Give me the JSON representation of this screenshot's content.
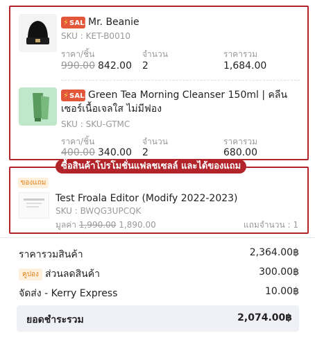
{
  "sale_label": "SALE",
  "col_labels": {
    "price": "ราคา/ชิ้น",
    "qty": "จำนวน",
    "total": "ราคารวม"
  },
  "items": [
    {
      "name": "Mr. Beanie",
      "sku": "SKU : KET-B0010",
      "original_price": "990.00",
      "price": "842.00",
      "qty": "2",
      "total": "1,684.00"
    },
    {
      "name": "Green Tea Morning Cleanser 150ml | คลีนเซอร์เนื้อเจลใส ไม่มีฟอง",
      "sku": "SKU : SKU-GTMC",
      "original_price": "400.00",
      "price": "340.00",
      "qty": "2",
      "total": "680.00"
    }
  ],
  "promo_banner": "ซื้อสินค้าโปรโมชั่นแฟลชเซลล์ และได้ของแถม",
  "gift": {
    "tag": "ของแถม",
    "name": "Test Froala Editor (Modify 2022-2023)",
    "sku": "SKU : BWQG3UPCQK",
    "value_label": "มูลค่า",
    "original_value": "1,990.00",
    "value": "1,890.00",
    "qty_label": "แถมจำนวน : 1"
  },
  "summary": {
    "subtotal_label": "ราคารวมสินค้า",
    "subtotal": "2,364.00฿",
    "coupon_tag": "คูปอง",
    "discount_label": "ส่วนลดสินค้า",
    "discount": "300.00฿",
    "shipping_label": "จัดส่ง - Kerry Express",
    "shipping": "10.00฿",
    "grand_total_label": "ยอดชำระรวม",
    "grand_total": "2,074.00฿"
  },
  "colors": {
    "accent_red": "#b3242a",
    "sale_orange": "#e2573a",
    "gift_orange": "#e0821d"
  }
}
